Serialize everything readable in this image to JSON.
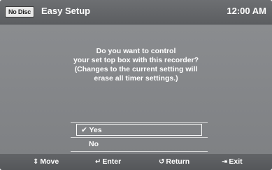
{
  "header": {
    "disc_status": "No Disc",
    "title": "Easy Setup",
    "time": "12:00 AM"
  },
  "prompt": {
    "lines": [
      "Do you want to control",
      "your set top box with this recorder?",
      "(Changes to the current setting will",
      "erase all timer settings.)"
    ]
  },
  "options": {
    "yes": "Yes",
    "yes_check": "✔",
    "no": "No",
    "selected": "Yes"
  },
  "footer": {
    "move_icon": "⇕",
    "move": "Move",
    "enter_icon": "↵",
    "enter": "Enter",
    "return_icon": "↺",
    "return": "Return",
    "exit_icon": "⇥",
    "exit": "Exit"
  },
  "icons": {
    "move": "up-down-arrow-icon",
    "enter": "enter-icon",
    "return": "return-icon",
    "exit": "exit-icon",
    "check": "checkmark-icon"
  },
  "colors": {
    "panel": "#888a8d",
    "header": "#616366",
    "text": "#ffffff"
  }
}
